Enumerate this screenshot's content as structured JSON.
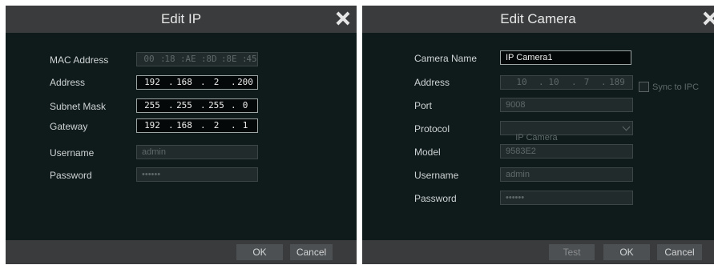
{
  "edit_ip": {
    "title": "Edit IP",
    "labels": {
      "mac": "MAC Address",
      "address": "Address",
      "subnet": "Subnet Mask",
      "gateway": "Gateway",
      "username": "Username",
      "password": "Password"
    },
    "mac": [
      "00",
      "18",
      "AE",
      "8D",
      "8E",
      "45"
    ],
    "address": [
      "192",
      "168",
      "2",
      "200"
    ],
    "subnet": [
      "255",
      "255",
      "255",
      "0"
    ],
    "gateway": [
      "192",
      "168",
      "2",
      "1"
    ],
    "username": "admin",
    "password": "••••••",
    "buttons": {
      "ok": "OK",
      "cancel": "Cancel"
    }
  },
  "edit_camera": {
    "title": "Edit Camera",
    "labels": {
      "camera_name": "Camera Name",
      "address": "Address",
      "port": "Port",
      "protocol": "Protocol",
      "model": "Model",
      "username": "Username",
      "password": "Password"
    },
    "camera_name": "IP Camera1",
    "address": [
      "10",
      "10",
      "7",
      "189"
    ],
    "sync_label": "Sync to IPC",
    "port": "9008",
    "protocol": "IP Camera",
    "model": "9583E2",
    "username": "admin",
    "password": "••••••",
    "buttons": {
      "test": "Test",
      "ok": "OK",
      "cancel": "Cancel"
    }
  },
  "icons": {
    "close": "close-icon",
    "dropdown": "chevron-down-icon"
  },
  "colors": {
    "dialog_bg": "#0f1b1b",
    "titlebar_bg": "#3a3b3d",
    "field_active_bg": "#050808",
    "field_disabled_bg": "#222b2b"
  }
}
